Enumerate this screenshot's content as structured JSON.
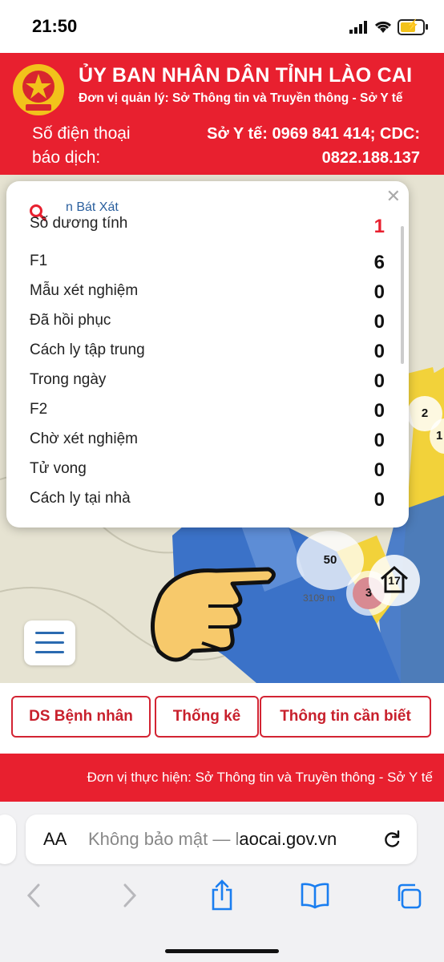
{
  "status_bar": {
    "time": "21:50"
  },
  "header": {
    "title": "ỦY BAN NHÂN DÂN TỈNH LÀO CAI",
    "subtitle": "Đơn vị quản lý: Sở Thông tin và Truyền thông - Sở Y tế",
    "phone_label": "Số điện thoại báo dịch:",
    "phone_line1": "Sở Y tế: 0969 841 414; CDC:",
    "phone_line2": "0822.188.137"
  },
  "panel": {
    "commune": "n Bát Xát",
    "rows": [
      {
        "label": "Số dương tính",
        "value": "1"
      },
      {
        "label": "F1",
        "value": "6"
      },
      {
        "label": "Mẫu xét nghiệm",
        "value": "0"
      },
      {
        "label": "Đã hồi phục",
        "value": "0"
      },
      {
        "label": "Cách ly tập trung",
        "value": "0"
      },
      {
        "label": "Trong ngày",
        "value": "0"
      },
      {
        "label": "F2",
        "value": "0"
      },
      {
        "label": "Chờ xét nghiệm",
        "value": "0"
      },
      {
        "label": "Tử vong",
        "value": "0"
      },
      {
        "label": "Cách ly tại nhà",
        "value": "0"
      }
    ]
  },
  "map": {
    "clusters": [
      "50",
      "3",
      "17",
      "2",
      "1"
    ],
    "elevation": "3109 m"
  },
  "tabs": [
    "DS Bệnh nhân",
    "Thống kê",
    "Thông tin cần biết"
  ],
  "footer": {
    "text": "Đơn vị thực hiện: Sở Thông tin và Truyền thông - Sở Y tế"
  },
  "browser": {
    "aa_label": "AA",
    "url_prefix": "Không bảo mật — l",
    "url_domain": "aocai.gov.vn"
  },
  "colors": {
    "brand_red": "#e8202f",
    "map_blue": "#3b72c8",
    "map_yellow": "#f2d23a"
  }
}
